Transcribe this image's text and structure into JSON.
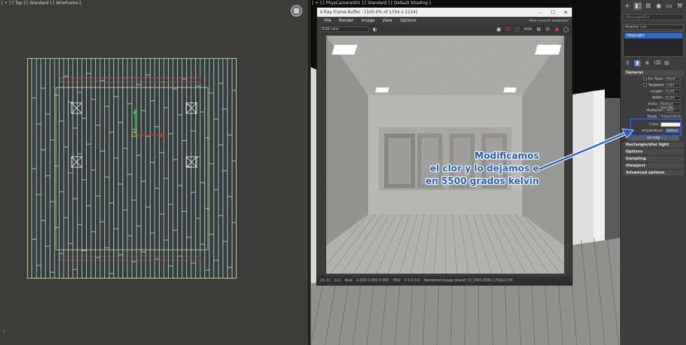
{
  "viewport_left": {
    "label": "[ + ] [ Top ] [ Standard ] [ Wireframe ]",
    "corner_axis": "y"
  },
  "viewport_right": {
    "label": "[ + ] [ PhysCamera001 ] [ Standard ] [ Default Shading ]"
  },
  "vfb": {
    "title": "V-Ray Frame Buffer - [100.0% of 1754 x 1134]",
    "menu": [
      "File",
      "Render",
      "Image",
      "View",
      "Options"
    ],
    "notice": "New version available!",
    "channel": "RGB color",
    "zoom": "100%",
    "status": {
      "coords": "[0, 0]",
      "mode": "1x1",
      "raw": "Raw",
      "values": "0.000   0.000   0.000",
      "hsv_label": "HSV",
      "hsv": "0   0.0   0.0",
      "info": "Rendered image (linear) (2_0001.EXR) 1754x1134"
    }
  },
  "command_panel": {
    "object_name": "VRayLight001",
    "modifier_list": "Modifier List",
    "stack_item": "VRayLight",
    "rollouts": {
      "general": "General",
      "rect": "Rectangle/disc light",
      "options": "Options",
      "sampling": "Sampling",
      "viewport": "Viewport",
      "advanced": "Advanced options"
    },
    "fields": {
      "on_label": "On",
      "type_label": "Type:",
      "type_value": "Plane",
      "targeted_label": "Targeted",
      "targeted_value": "2,0m",
      "length_label": "Length:",
      "length_value": "0,2m",
      "width_label": "Width:",
      "width_value": "0,2m",
      "units_label": "Units:",
      "units_value": "Radiant pwr (W)",
      "multiplier_label": "Multiplier:",
      "multiplier_value": "30,0",
      "mode_label": "Mode:",
      "mode_value": "Temperature",
      "color_label": "Color:",
      "temperature_label": "emperature:",
      "temperature_value": "5500,0",
      "texture_button": "No Map"
    },
    "light_color": "#fbf4e8"
  },
  "annotation": {
    "line1": "Modificamos",
    "line2": "el clor y lo dejamos e",
    "line3": "en 5500 grados kelvin",
    "color": "#1f5bd6"
  }
}
